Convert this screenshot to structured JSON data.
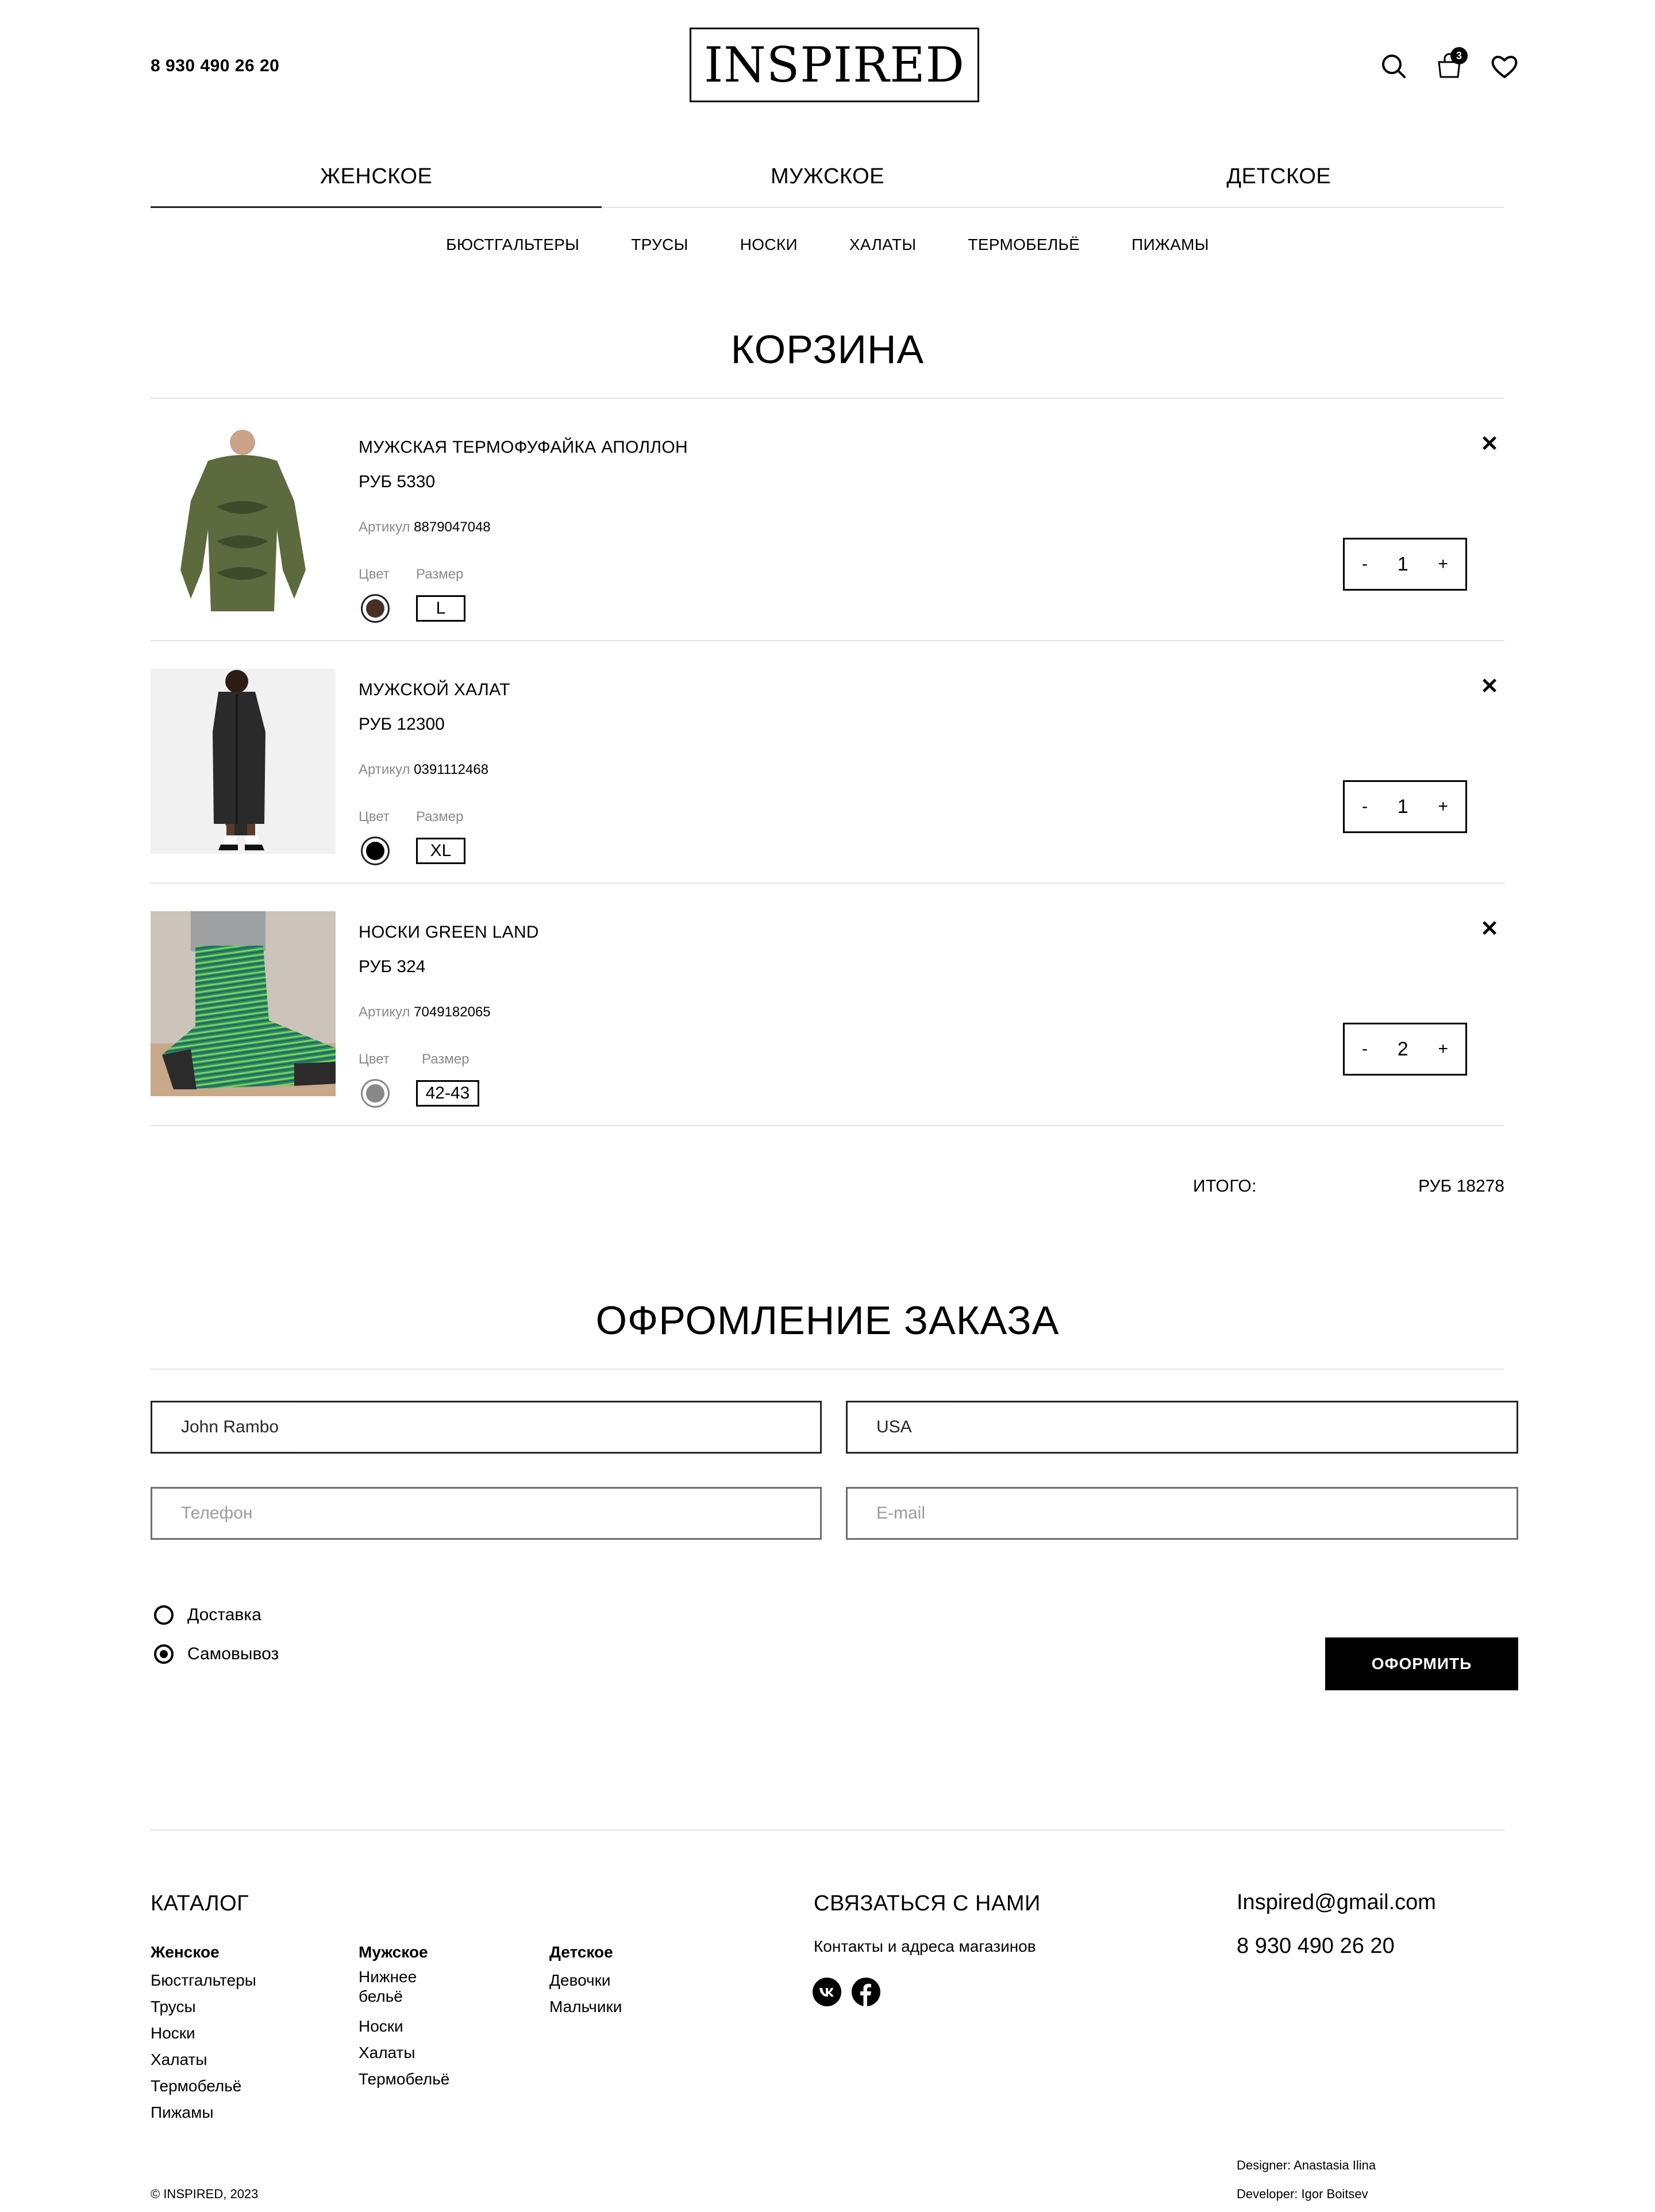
{
  "header": {
    "phone": "8 930 490 26 20",
    "logo": "INSPIRED",
    "cart_count": "3"
  },
  "main_nav": [
    {
      "label": "ЖЕНСКОЕ",
      "active": true
    },
    {
      "label": "МУЖСКОЕ",
      "active": false
    },
    {
      "label": "ДЕТСКОЕ",
      "active": false
    }
  ],
  "sub_nav": [
    "БЮСТГАЛЬТЕРЫ",
    "ТРУСЫ",
    "НОСКИ",
    "ХАЛАТЫ",
    "ТЕРМОБЕЛЬЁ",
    "ПИЖАМЫ"
  ],
  "cart": {
    "title": "КОРЗИНА",
    "items": [
      {
        "name": "МУЖСКАЯ ТЕРМОФУФАЙКА АПОЛЛОН",
        "price": "РУБ 5330",
        "article_label": "Артикул",
        "article": "8879047048",
        "color_label": "Цвет",
        "size_label": "Размер",
        "size": "L",
        "color": "#4a2f24",
        "qty": "1"
      },
      {
        "name": "МУЖСКОЙ ХАЛАТ",
        "price": "РУБ 12300",
        "article_label": "Артикул",
        "article": "0391112468",
        "color_label": "Цвет",
        "size_label": "Размер",
        "size": "XL",
        "color": "#000000",
        "qty": "1"
      },
      {
        "name": "НОСКИ GREEN LAND",
        "price": "РУБ 324",
        "article_label": "Артикул",
        "article": "7049182065",
        "color_label": "Цвет",
        "size_label": "Размер",
        "size": "42-43",
        "color": "#888888",
        "qty": "2"
      }
    ],
    "total_label": "ИТОГО:",
    "total_value": "РУБ 18278",
    "minus": "-",
    "plus": "+",
    "remove": "✕"
  },
  "order": {
    "title": "ОФРОМЛЕНИЕ ЗАКАЗА",
    "name_value": "John Rambo",
    "address_value": "USA",
    "phone_placeholder": "Телефон",
    "email_placeholder": "E-mail",
    "delivery_label": "Доставка",
    "pickup_label": "Самовывоз",
    "selected": "pickup",
    "submit": "ОФОРМИТЬ"
  },
  "footer": {
    "catalog_title": "КАТАЛОГ",
    "columns": [
      {
        "title": "Женское",
        "links": [
          "Бюстгальтеры",
          "Трусы",
          "Носки",
          "Халаты",
          "Термобельё",
          "Пижамы"
        ]
      },
      {
        "title": "Мужское",
        "links": [
          "Нижнее бельё",
          "Носки",
          "Халаты",
          "Термобельё"
        ]
      },
      {
        "title": "Детское",
        "links": [
          "Девочки",
          "Мальчики"
        ]
      }
    ],
    "contact_title": "СВЯЗАТЬСЯ С НАМИ",
    "contact_link": "Контакты и адреса магазинов",
    "email": "Inspired@gmail.com",
    "phone": "8 930 490 26 20",
    "designer": "Designer: Anastasia Ilina",
    "developer": "Developer: Igor Boitsev",
    "copyright": "© INSPIRED, 2023"
  }
}
